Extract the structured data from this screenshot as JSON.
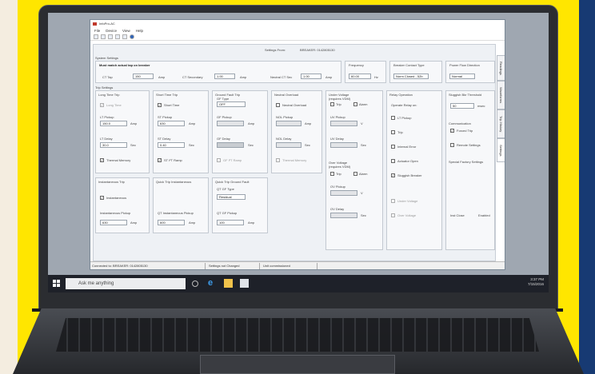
{
  "app": {
    "title": "InfoPro-AC"
  },
  "menu": [
    "File",
    "Device",
    "View",
    "Help"
  ],
  "header": {
    "settings_from_label": "Settings From:",
    "settings_from_value": "BREAKER: 0142805130"
  },
  "system": {
    "title": "System Settings",
    "warning": "Must match actual tap on breaker",
    "ct_tap_label": "CT Tap",
    "ct_tap_value": "150",
    "ct_tap_unit": "Amp",
    "ct_secondary_label": "CT Secondary",
    "ct_secondary_value": "1.00",
    "ct_secondary_unit": "Amp",
    "neutral_ct_label": "Neutral CT Sec",
    "neutral_ct_value": "1.00",
    "neutral_ct_unit": "Amp",
    "frequency_label": "Frequency",
    "frequency_value": "60.00",
    "frequency_unit": "Hz",
    "contact_label": "Breaker Contact Type",
    "contact_value": "Norm Closed - 52b",
    "power_label": "Power Flow Direction",
    "power_value": "Normal"
  },
  "trip": {
    "title": "Trip Settings",
    "long": {
      "title": "Long Time Trip",
      "enable": "Long Time",
      "pickup_label": "LT Pickup",
      "pickup_value": "150.0",
      "pickup_unit": "Amp",
      "delay_label": "LT Delay",
      "delay_value": "30.0",
      "delay_unit": "Sec",
      "memory": "Thermal Memory"
    },
    "short": {
      "title": "Short Time Trip",
      "enable": "Short Time",
      "pickup_label": "ST Pickup",
      "pickup_value": "630",
      "pickup_unit": "Amp",
      "delay_label": "ST Delay",
      "delay_value": "0.40",
      "delay_unit": "Sec",
      "ramp": "ST I²T Ramp"
    },
    "ground": {
      "title": "Ground Fault Trip",
      "type_label": "GF Type",
      "type_value": "OFF",
      "pickup_label": "GF Pickup",
      "pickup_unit": "Amp",
      "delay_label": "GF Delay",
      "delay_unit": "Sec",
      "ramp": "GF I²T Ramp"
    },
    "neutral": {
      "title": "Neutral Overload",
      "enable": "Neutral Overload",
      "pickup_label": "NOL Pickup",
      "pickup_unit": "Amp",
      "delay_label": "NOL Delay",
      "delay_unit": "Sec",
      "memory": "Thermal Memory"
    },
    "undervoltage": {
      "title": "Under Voltage",
      "subtitle": "(requires VDM)",
      "trip": "Trip",
      "alarm": "Alarm",
      "pickup_label": "UV Pickup",
      "pickup_unit": "V",
      "delay_label": "UV Delay",
      "delay_unit": "Sec"
    },
    "overvoltage": {
      "title": "Over Voltage",
      "subtitle": "(requires VDM)",
      "trip": "Trip",
      "alarm": "Alarm",
      "pickup_label": "OV Pickup",
      "pickup_unit": "V",
      "delay_label": "OV Delay",
      "delay_unit": "Sec"
    },
    "inst": {
      "title": "Instantaneous Trip",
      "enable": "Instantaneous",
      "pickup_label": "Instantaneous Pickup",
      "pickup_value": "630",
      "pickup_unit": "Amp"
    },
    "quick": {
      "title": "Quick Trip Instantaneous",
      "pickup_label": "QT Instantaneous Pickup",
      "pickup_value": "600",
      "pickup_unit": "Amp"
    },
    "quickgf": {
      "title": "Quick Trip Ground Fault",
      "type_label": "QT GF Type",
      "type_value": "Residual",
      "pickup_label": "QT GF Pickup",
      "pickup_value": "100",
      "pickup_unit": "Amp"
    },
    "relay": {
      "title": "Relay Operation",
      "operate": "Operate Relay on:",
      "items": [
        "LT Pickup",
        "Trip",
        "Internal Error",
        "Actuator Open",
        "Sluggish Breaker",
        "Under Voltage",
        "Over Voltage"
      ]
    },
    "sluggish": {
      "title": "Sluggish Bkr Threshold",
      "value": "50",
      "unit": "msec"
    },
    "comm": {
      "title": "Communication",
      "forced": "Forced Trip",
      "remote": "Remote Settings"
    },
    "factory": {
      "title": "Special Factory Settings",
      "inst_label": "Inst Close",
      "inst_value": "Enabled"
    }
  },
  "tabs": [
    "Settings",
    "Trip History",
    "Waveforms",
    "Readings"
  ],
  "status": [
    "Connected to: BREAKER: 0142805130",
    "Settings not Changed",
    "Unit commissioned"
  ],
  "taskbar": {
    "search_placeholder": "Ask me anything",
    "time": "3:37 PM",
    "date": "7/15/2016"
  }
}
